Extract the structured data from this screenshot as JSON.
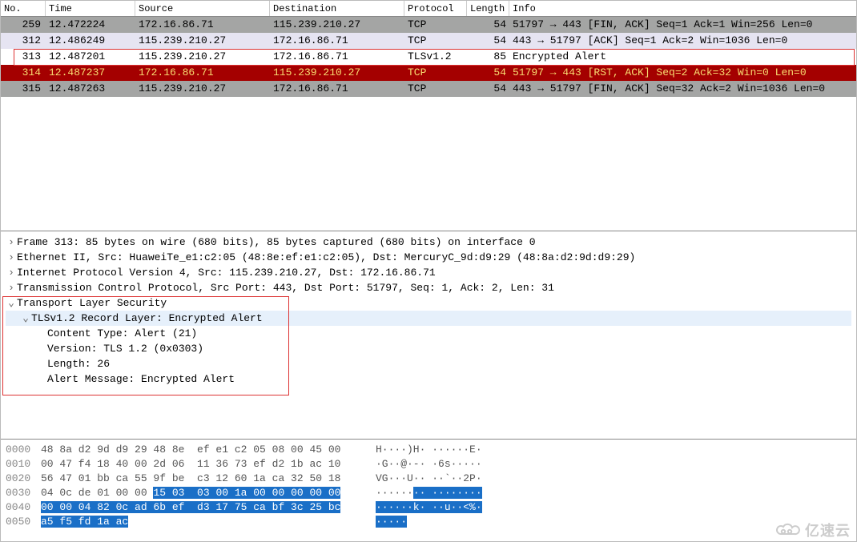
{
  "packet_list": {
    "columns": {
      "no": "No.",
      "time": "Time",
      "src": "Source",
      "dst": "Destination",
      "prot": "Protocol",
      "len": "Length",
      "info": "Info"
    },
    "rows": [
      {
        "no": "259",
        "time": "12.472224",
        "src": "172.16.86.71",
        "dst": "115.239.210.27",
        "prot": "TCP",
        "len": "54",
        "info": "51797 → 443 [FIN, ACK] Seq=1 Ack=1 Win=256 Len=0",
        "state": "gray"
      },
      {
        "no": "312",
        "time": "12.486249",
        "src": "115.239.210.27",
        "dst": "172.16.86.71",
        "prot": "TCP",
        "len": "54",
        "info": "443 → 51797 [ACK] Seq=1 Ack=2 Win=1036 Len=0",
        "state": "lav"
      },
      {
        "no": "313",
        "time": "12.487201",
        "src": "115.239.210.27",
        "dst": "172.16.86.71",
        "prot": "TLSv1.2",
        "len": "85",
        "info": "Encrypted Alert",
        "state": "white",
        "boxed": true
      },
      {
        "no": "314",
        "time": "12.487237",
        "src": "172.16.86.71",
        "dst": "115.239.210.27",
        "prot": "TCP",
        "len": "54",
        "info": "51797 → 443 [RST, ACK] Seq=2 Ack=32 Win=0 Len=0",
        "state": "red"
      },
      {
        "no": "315",
        "time": "12.487263",
        "src": "115.239.210.27",
        "dst": "172.16.86.71",
        "prot": "TCP",
        "len": "54",
        "info": "443 → 51797 [FIN, ACK] Seq=32 Ack=2 Win=1036 Len=0",
        "state": "gray"
      }
    ]
  },
  "details": {
    "frame": "Frame 313: 85 bytes on wire (680 bits), 85 bytes captured (680 bits) on interface 0",
    "eth": "Ethernet II, Src: HuaweiTe_e1:c2:05 (48:8e:ef:e1:c2:05), Dst: MercuryC_9d:d9:29 (48:8a:d2:9d:d9:29)",
    "ip": "Internet Protocol Version 4, Src: 115.239.210.27, Dst: 172.16.86.71",
    "tcp": "Transmission Control Protocol, Src Port: 443, Dst Port: 51797, Seq: 1, Ack: 2, Len: 31",
    "tls": "Transport Layer Security",
    "record": "TLSv1.2 Record Layer: Encrypted Alert",
    "ctype": "Content Type: Alert (21)",
    "version": "Version: TLS 1.2 (0x0303)",
    "length": "Length: 26",
    "alert": "Alert Message: Encrypted Alert"
  },
  "hex": {
    "rows": [
      {
        "off": "0000",
        "b": "48 8a d2 9d d9 29 48 8e  ef e1 c2 05 08 00 45 00",
        "a": "H····)H· ······E·"
      },
      {
        "off": "0010",
        "b": "00 47 f4 18 40 00 2d 06  11 36 73 ef d2 1b ac 10",
        "a": "·G··@·-· ·6s·····"
      },
      {
        "off": "0020",
        "b": "56 47 01 bb ca 55 9f be  c3 12 60 1a ca 32 50 18",
        "a": "VG···U·· ··`··2P·"
      },
      {
        "off": "0030",
        "b": "04 0c de 01 00 00 ",
        "hb": "15 03  03 00 1a 00 00 00 00 00",
        "a": "······",
        "ha": "·· ········"
      },
      {
        "off": "0040",
        "hb": "00 00 04 82 0c ad 6b ef  d3 17 75 ca bf 3c 25 bc",
        "ha": "······k· ··u··<%·"
      },
      {
        "off": "0050",
        "hb": "a5 f5 fd 1a ac",
        "ha": "·····"
      }
    ]
  },
  "watermark": "亿速云"
}
